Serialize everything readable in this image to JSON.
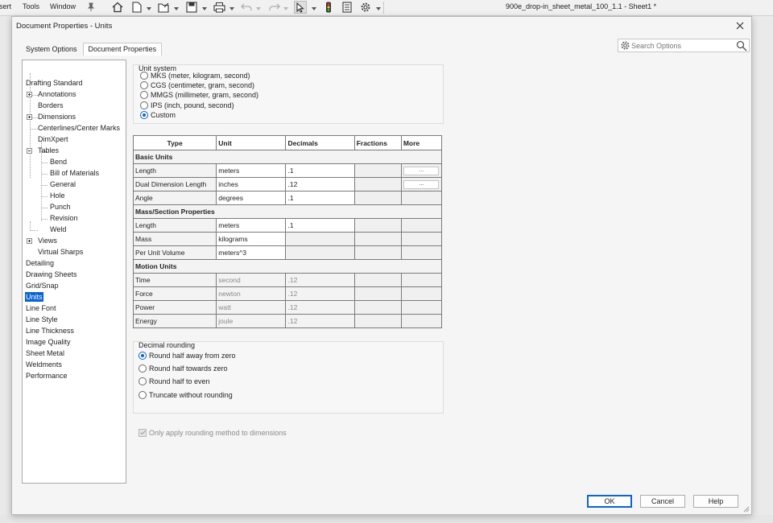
{
  "app": {
    "menu": [
      "sert",
      "Tools",
      "Window"
    ],
    "title": "900e_drop-in_sheet_metal_100_1.1 - Sheet1 *"
  },
  "dialog": {
    "title": "Document Properties - Units",
    "tabs": [
      {
        "label": "System Options",
        "active": false
      },
      {
        "label": "Document Properties",
        "active": true
      }
    ],
    "search_placeholder": "Search Options"
  },
  "tree": {
    "items": [
      {
        "label": "Drafting Standard",
        "level": 0
      },
      {
        "label": "Annotations",
        "level": 1,
        "expander": "plus"
      },
      {
        "label": "Borders",
        "level": 1
      },
      {
        "label": "Dimensions",
        "level": 1,
        "expander": "plus"
      },
      {
        "label": "Centerlines/Center Marks",
        "level": 1
      },
      {
        "label": "DimXpert",
        "level": 1
      },
      {
        "label": "Tables",
        "level": 1,
        "expander": "minus"
      },
      {
        "label": "Bend",
        "level": 2
      },
      {
        "label": "Bill of Materials",
        "level": 2
      },
      {
        "label": "General",
        "level": 2
      },
      {
        "label": "Hole",
        "level": 2
      },
      {
        "label": "Punch",
        "level": 2
      },
      {
        "label": "Revision",
        "level": 2
      },
      {
        "label": "Weld",
        "level": 2
      },
      {
        "label": "Views",
        "level": 1,
        "expander": "plus"
      },
      {
        "label": "Virtual Sharps",
        "level": 1
      },
      {
        "label": "Detailing",
        "level": 0
      },
      {
        "label": "Drawing Sheets",
        "level": 0
      },
      {
        "label": "Grid/Snap",
        "level": 0
      },
      {
        "label": "Units",
        "level": 0,
        "selected": true
      },
      {
        "label": "Line Font",
        "level": 0
      },
      {
        "label": "Line Style",
        "level": 0
      },
      {
        "label": "Line Thickness",
        "level": 0
      },
      {
        "label": "Image Quality",
        "level": 0
      },
      {
        "label": "Sheet Metal",
        "level": 0
      },
      {
        "label": "Weldments",
        "level": 0
      },
      {
        "label": "Performance",
        "level": 0
      }
    ]
  },
  "unit_system": {
    "title": "Unit system",
    "options": [
      {
        "label": "MKS  (meter, kilogram, second)",
        "selected": false
      },
      {
        "label": "CGS  (centimeter, gram, second)",
        "selected": false
      },
      {
        "label": "MMGS (millimeter, gram, second)",
        "selected": false
      },
      {
        "label": "IPS  (inch, pound, second)",
        "selected": false
      },
      {
        "label": "Custom",
        "selected": true
      }
    ]
  },
  "units_table": {
    "headers": [
      "Type",
      "Unit",
      "Decimals",
      "Fractions",
      "More"
    ],
    "sections": [
      {
        "name": "Basic Units",
        "rows": [
          {
            "type": "Length",
            "unit": "meters",
            "decimals": ".1",
            "fractions": "",
            "more": "...",
            "editable": true
          },
          {
            "type": "Dual Dimension Length",
            "unit": "inches",
            "decimals": ".12",
            "fractions": "",
            "more": "...",
            "editable": true
          },
          {
            "type": "Angle",
            "unit": "degrees",
            "decimals": ".1",
            "fractions": "",
            "more": "",
            "editable": true
          }
        ]
      },
      {
        "name": "Mass/Section Properties",
        "rows": [
          {
            "type": "Length",
            "unit": "meters",
            "decimals": ".1",
            "fractions": "",
            "more": "",
            "editable": true
          },
          {
            "type": "Mass",
            "unit": "kilograms",
            "decimals": "",
            "fractions": "",
            "more": "",
            "editable": true
          },
          {
            "type": "Per Unit Volume",
            "unit": "meters^3",
            "decimals": "",
            "fractions": "",
            "more": "",
            "editable": true
          }
        ]
      },
      {
        "name": "Motion Units",
        "rows": [
          {
            "type": "Time",
            "unit": "second",
            "decimals": ".12",
            "fractions": "",
            "more": "",
            "editable": false
          },
          {
            "type": "Force",
            "unit": "newton",
            "decimals": ".12",
            "fractions": "",
            "more": "",
            "editable": false
          },
          {
            "type": "Power",
            "unit": "watt",
            "decimals": ".12",
            "fractions": "",
            "more": "",
            "editable": false
          },
          {
            "type": "Energy",
            "unit": "joule",
            "decimals": ".12",
            "fractions": "",
            "more": "",
            "editable": false
          }
        ]
      }
    ]
  },
  "decimal_rounding": {
    "title": "Decimal rounding",
    "options": [
      {
        "label": "Round half away from zero",
        "selected": true
      },
      {
        "label": "Round half towards zero",
        "selected": false
      },
      {
        "label": "Round half to even",
        "selected": false
      },
      {
        "label": "Truncate without rounding",
        "selected": false
      }
    ]
  },
  "only_apply_rounding": {
    "label": "Only apply rounding method to dimensions",
    "checked": true,
    "disabled": true
  },
  "buttons": {
    "ok": "OK",
    "cancel": "Cancel",
    "help": "Help"
  },
  "colors": {
    "accent": "#0a64d2",
    "disabled_text": "#8a8a8a"
  }
}
